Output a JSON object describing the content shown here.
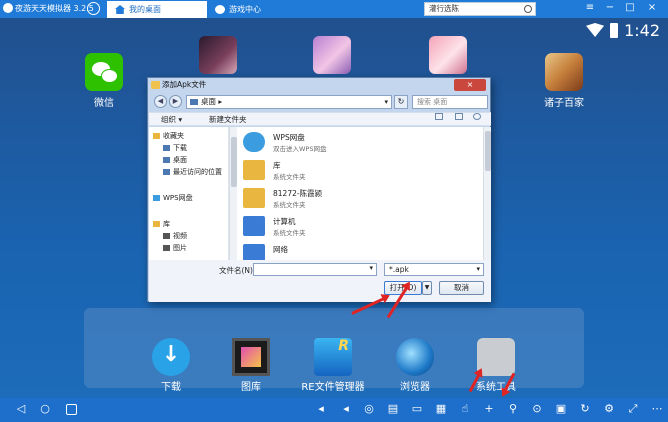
{
  "app": {
    "title": "夜游天天模拟器 3.2.5",
    "tabs": [
      {
        "label": "我的桌面",
        "icon": "home-icon"
      },
      {
        "label": "游戏中心",
        "icon": "gamepad-icon"
      }
    ],
    "search_value": "灌行选陈",
    "window_controls": [
      "≡",
      "−",
      "□",
      "×"
    ]
  },
  "status": {
    "time": "1:42"
  },
  "desktop": {
    "apps": [
      {
        "label": "微信",
        "icon": "wechat-icon"
      },
      {
        "label": "诸子百家",
        "icon": "zhuzi-baijia-icon"
      }
    ],
    "games": [
      "game-1-icon",
      "game-2-icon",
      "game-3-icon"
    ]
  },
  "dock": [
    {
      "label": "下载",
      "icon": "download-icon"
    },
    {
      "label": "图库",
      "icon": "gallery-icon"
    },
    {
      "label": "RE文件管理器",
      "icon": "re-file-manager-icon"
    },
    {
      "label": "浏览器",
      "icon": "browser-icon"
    },
    {
      "label": "系统工具",
      "icon": "system-tools-icon"
    }
  ],
  "dialog": {
    "title": "添加Apk文件",
    "close": "×",
    "address": "桌面",
    "address_sep": "▸",
    "search_placeholder": "搜索 桌面",
    "toolbar": {
      "organize": "组织 ▾",
      "new_folder": "新建文件夹"
    },
    "nav_items": [
      {
        "label": "收藏夹",
        "indent": 0,
        "color": "#e9b640"
      },
      {
        "label": "下载",
        "indent": 1,
        "color": "#4d79b3"
      },
      {
        "label": "桌面",
        "indent": 1,
        "color": "#4d79b3"
      },
      {
        "label": "最近访问的位置",
        "indent": 1,
        "color": "#4d79b3"
      },
      {
        "label": "WPS网盘",
        "indent": 0,
        "color": "#3b9de0"
      },
      {
        "label": "库",
        "indent": 0,
        "color": "#e9b640"
      },
      {
        "label": "视频",
        "indent": 1,
        "color": "#555"
      },
      {
        "label": "图片",
        "indent": 1,
        "color": "#555"
      }
    ],
    "files": [
      {
        "name": "WPS网盘",
        "type": "双击进入WPS网盘",
        "icon": "cloud-icon",
        "color": "#3b9de0"
      },
      {
        "name": "库",
        "type": "系统文件夹",
        "icon": "library-folder-icon",
        "color": "#e9b640"
      },
      {
        "name": "81272-陈霞颍",
        "type": "系统文件夹",
        "icon": "user-folder-icon",
        "color": "#e9b640"
      },
      {
        "name": "计算机",
        "type": "系统文件夹",
        "icon": "computer-icon",
        "color": "#3a7bd5"
      },
      {
        "name": "网络",
        "type": "",
        "icon": "network-icon",
        "color": "#3a7bd5"
      }
    ],
    "filename_label": "文件名(N):",
    "filename_value": "",
    "filetype": "*.apk",
    "open_label": "打开(O)",
    "cancel_label": "取消"
  }
}
